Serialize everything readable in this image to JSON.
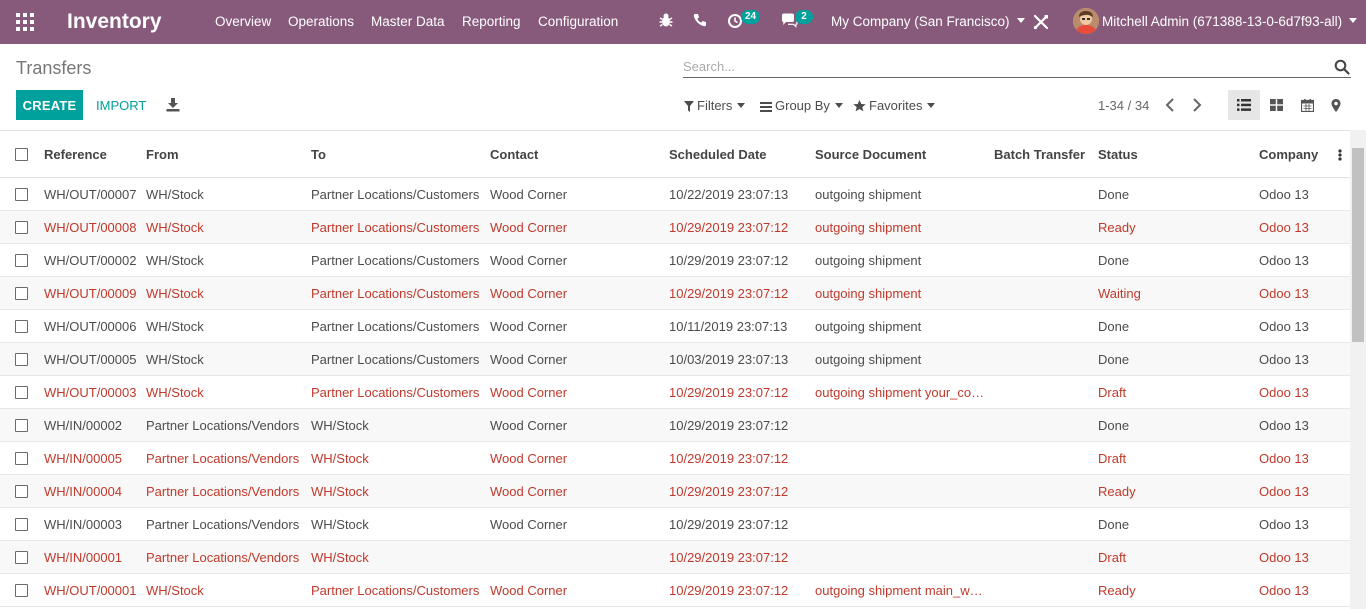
{
  "navbar": {
    "app_title": "Inventory",
    "menu": [
      "Overview",
      "Operations",
      "Master Data",
      "Reporting",
      "Configuration"
    ],
    "activity_count": "24",
    "message_count": "2",
    "company": "My Company (San Francisco)",
    "user": "Mitchell Admin (671388-13-0-6d7f93-all)"
  },
  "control_panel": {
    "breadcrumb": "Transfers",
    "search_placeholder": "Search...",
    "create_label": "CREATE",
    "import_label": "IMPORT",
    "filters_label": "Filters",
    "group_by_label": "Group By",
    "favorites_label": "Favorites",
    "pager": "1-34 / 34"
  },
  "colors": {
    "navbar": "#875a7b",
    "primary": "#00a09d",
    "late_row": "#c0392b"
  },
  "columns": [
    "Reference",
    "From",
    "To",
    "Contact",
    "Scheduled Date",
    "Source Document",
    "Batch Transfer",
    "Status",
    "Company"
  ],
  "rows": [
    {
      "late": false,
      "cells": [
        "WH/OUT/00007",
        "WH/Stock",
        "Partner Locations/Customers",
        "Wood Corner",
        "10/22/2019 23:07:13",
        "outgoing shipment",
        "",
        "Done",
        "Odoo 13"
      ]
    },
    {
      "late": true,
      "cells": [
        "WH/OUT/00008",
        "WH/Stock",
        "Partner Locations/Customers",
        "Wood Corner",
        "10/29/2019 23:07:12",
        "outgoing shipment",
        "",
        "Ready",
        "Odoo 13"
      ]
    },
    {
      "late": false,
      "cells": [
        "WH/OUT/00002",
        "WH/Stock",
        "Partner Locations/Customers",
        "Wood Corner",
        "10/29/2019 23:07:12",
        "outgoing shipment",
        "",
        "Done",
        "Odoo 13"
      ]
    },
    {
      "late": true,
      "cells": [
        "WH/OUT/00009",
        "WH/Stock",
        "Partner Locations/Customers",
        "Wood Corner",
        "10/29/2019 23:07:12",
        "outgoing shipment",
        "",
        "Waiting",
        "Odoo 13"
      ]
    },
    {
      "late": false,
      "cells": [
        "WH/OUT/00006",
        "WH/Stock",
        "Partner Locations/Customers",
        "Wood Corner",
        "10/11/2019 23:07:13",
        "outgoing shipment",
        "",
        "Done",
        "Odoo 13"
      ]
    },
    {
      "late": false,
      "cells": [
        "WH/OUT/00005",
        "WH/Stock",
        "Partner Locations/Customers",
        "Wood Corner",
        "10/03/2019 23:07:13",
        "outgoing shipment",
        "",
        "Done",
        "Odoo 13"
      ]
    },
    {
      "late": true,
      "cells": [
        "WH/OUT/00003",
        "WH/Stock",
        "Partner Locations/Customers",
        "Wood Corner",
        "10/29/2019 23:07:12",
        "outgoing shipment your_company_ticket",
        "",
        "Draft",
        "Odoo 13"
      ]
    },
    {
      "late": false,
      "cells": [
        "WH/IN/00002",
        "Partner Locations/Vendors",
        "WH/Stock",
        "Wood Corner",
        "10/29/2019 23:07:12",
        "",
        "",
        "Done",
        "Odoo 13"
      ]
    },
    {
      "late": true,
      "cells": [
        "WH/IN/00005",
        "Partner Locations/Vendors",
        "WH/Stock",
        "Wood Corner",
        "10/29/2019 23:07:12",
        "",
        "",
        "Draft",
        "Odoo 13"
      ]
    },
    {
      "late": true,
      "cells": [
        "WH/IN/00004",
        "Partner Locations/Vendors",
        "WH/Stock",
        "Wood Corner",
        "10/29/2019 23:07:12",
        "",
        "",
        "Ready",
        "Odoo 13"
      ]
    },
    {
      "late": false,
      "cells": [
        "WH/IN/00003",
        "Partner Locations/Vendors",
        "WH/Stock",
        "Wood Corner",
        "10/29/2019 23:07:12",
        "",
        "",
        "Done",
        "Odoo 13"
      ]
    },
    {
      "late": true,
      "cells": [
        "WH/IN/00001",
        "Partner Locations/Vendors",
        "WH/Stock",
        "",
        "10/29/2019 23:07:12",
        "",
        "",
        "Draft",
        "Odoo 13"
      ]
    },
    {
      "late": true,
      "cells": [
        "WH/OUT/00001",
        "WH/Stock",
        "Partner Locations/Customers",
        "Wood Corner",
        "10/29/2019 23:07:12",
        "outgoing shipment main_warehouse",
        "",
        "Ready",
        "Odoo 13"
      ]
    }
  ]
}
